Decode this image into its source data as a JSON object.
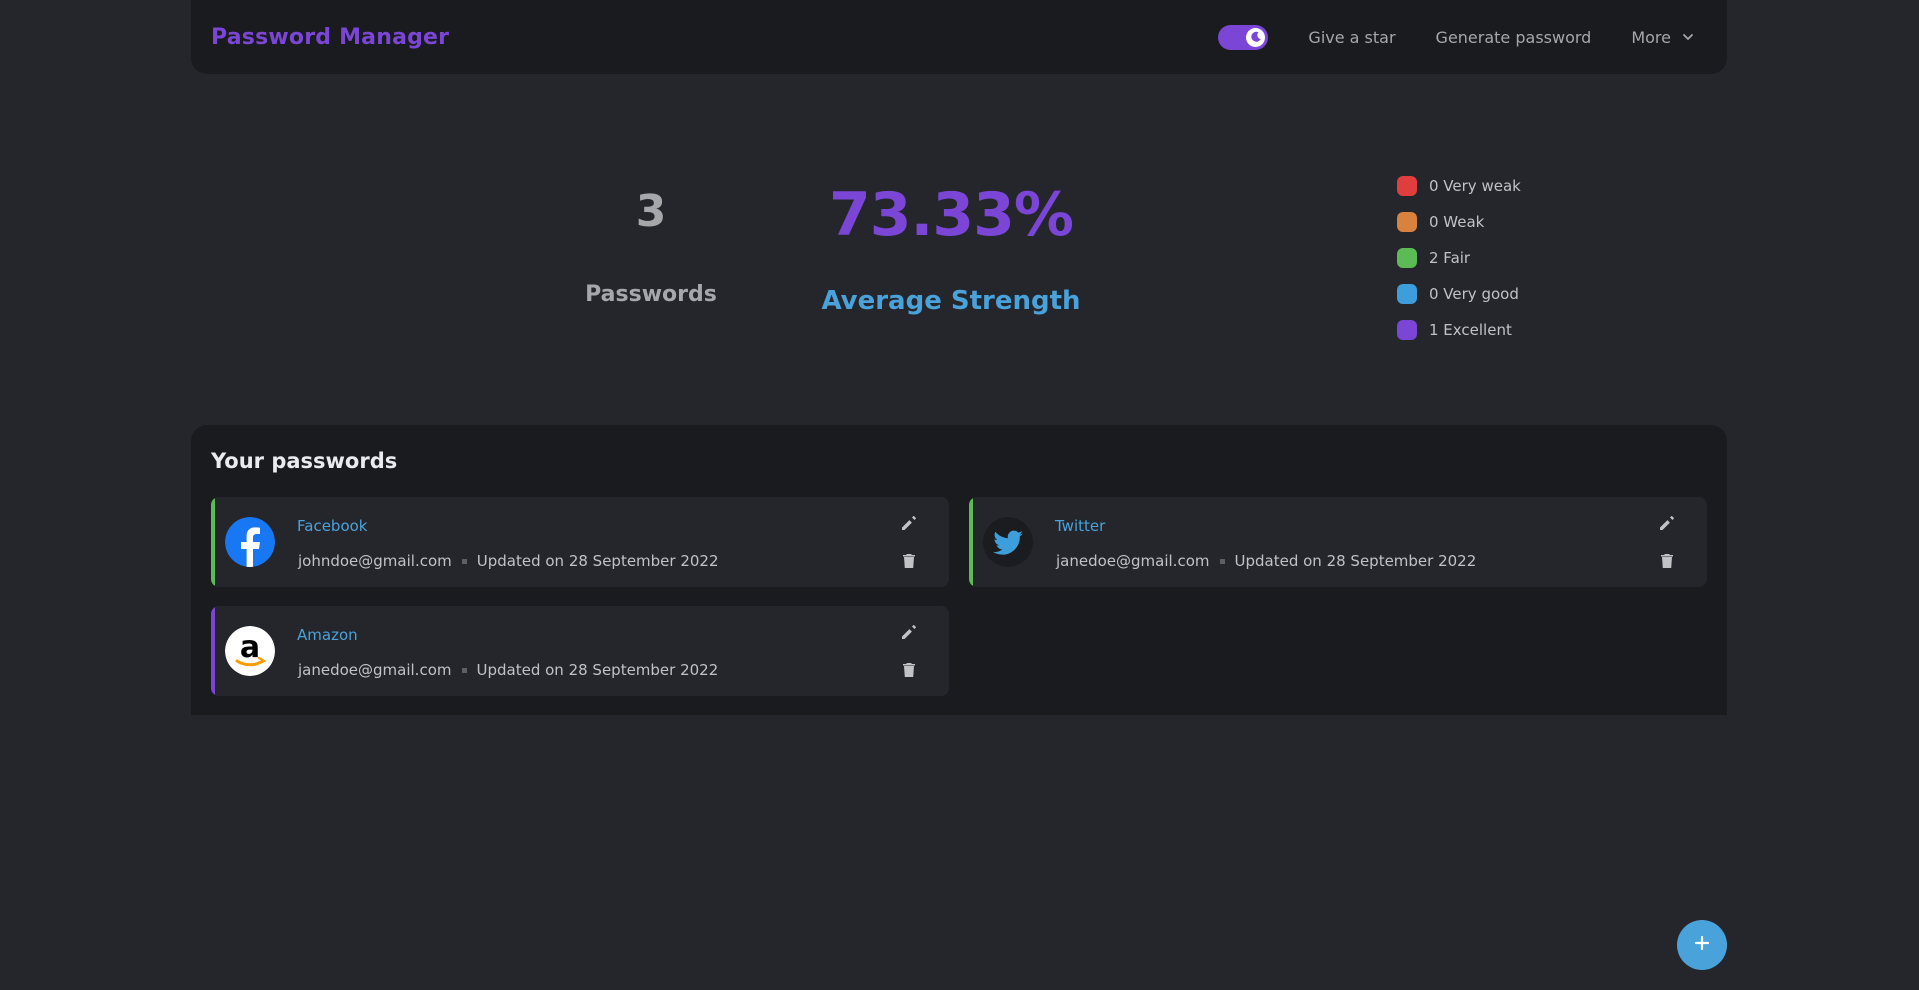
{
  "header": {
    "title": "Password Manager",
    "theme_toggle_icon": "moon-icon",
    "links": {
      "star": "Give a star",
      "generate": "Generate password",
      "more": "More"
    }
  },
  "stats": {
    "count": "3",
    "count_label": "Passwords",
    "average": "73.33%",
    "average_label": "Average Strength"
  },
  "legend": [
    {
      "label": "0 Very weak",
      "color": "#e03e3e"
    },
    {
      "label": "0 Weak",
      "color": "#d9813e"
    },
    {
      "label": "2 Fair",
      "color": "#5dbb55"
    },
    {
      "label": "0 Very good",
      "color": "#3d9edb"
    },
    {
      "label": "1 Excellent",
      "color": "#7b45d6"
    }
  ],
  "passwords": {
    "title": "Your passwords",
    "items": [
      {
        "name": "Facebook",
        "email": "johndoe@gmail.com",
        "updated": "Updated on 28 September 2022",
        "strength_color": "#5dbb55",
        "icon": "facebook-logo"
      },
      {
        "name": "Twitter",
        "email": "janedoe@gmail.com",
        "updated": "Updated on 28 September 2022",
        "strength_color": "#5dbb55",
        "icon": "twitter-logo"
      },
      {
        "name": "Amazon",
        "email": "janedoe@gmail.com",
        "updated": "Updated on 28 September 2022",
        "strength_color": "#7b45d6",
        "icon": "amazon-logo"
      }
    ]
  },
  "fab_icon": "plus-icon"
}
